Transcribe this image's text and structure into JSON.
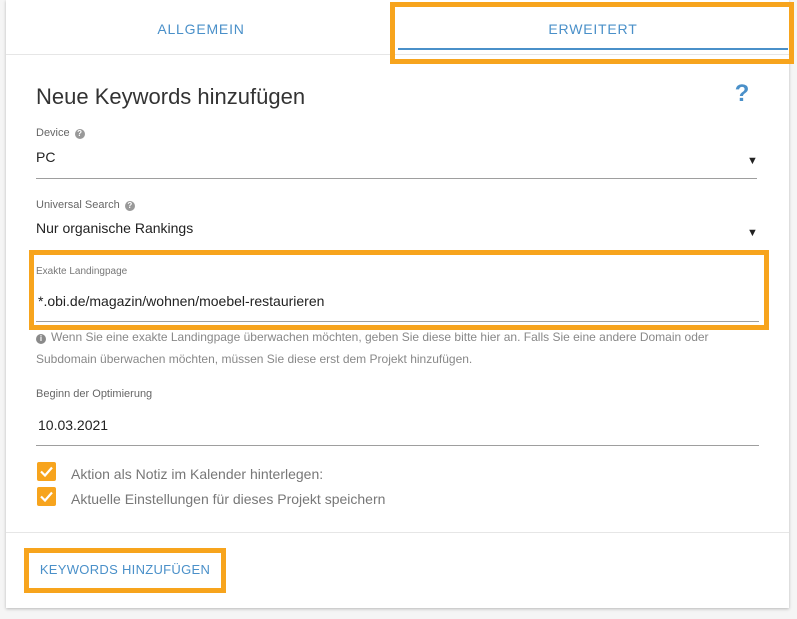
{
  "tabs": [
    {
      "label": "ALLGEMEIN"
    },
    {
      "label": "ERWEITERT"
    }
  ],
  "form": {
    "title": "Neue Keywords hinzufügen",
    "help_symbol": "?",
    "device": {
      "label": "Device",
      "value": "PC"
    },
    "universal_search": {
      "label": "Universal Search",
      "value": "Nur organische Rankings"
    },
    "landing_page": {
      "label": "Exakte Landingpage",
      "value": "*.obi.de/magazin/wohnen/moebel-restaurieren",
      "hint": "Wenn Sie eine exakte Landingpage überwachen möchten, geben Sie diese bitte hier an. Falls Sie eine andere Domain oder Subdomain überwachen möchten, müssen Sie diese erst dem Projekt hinzufügen."
    },
    "optimization_start": {
      "label": "Beginn der Optimierung",
      "value": "10.03.2021"
    },
    "checkboxes": [
      {
        "label": "Aktion als Notiz im Kalender hinterlegen:",
        "checked": true
      },
      {
        "label": "Aktuelle Einstellungen für dieses Projekt speichern",
        "checked": true
      }
    ],
    "submit_label": "KEYWORDS HINZUFÜGEN"
  },
  "colors": {
    "accent": "#4a90c9",
    "highlight": "#f7a41d",
    "checkbox": "#f7a41d"
  }
}
